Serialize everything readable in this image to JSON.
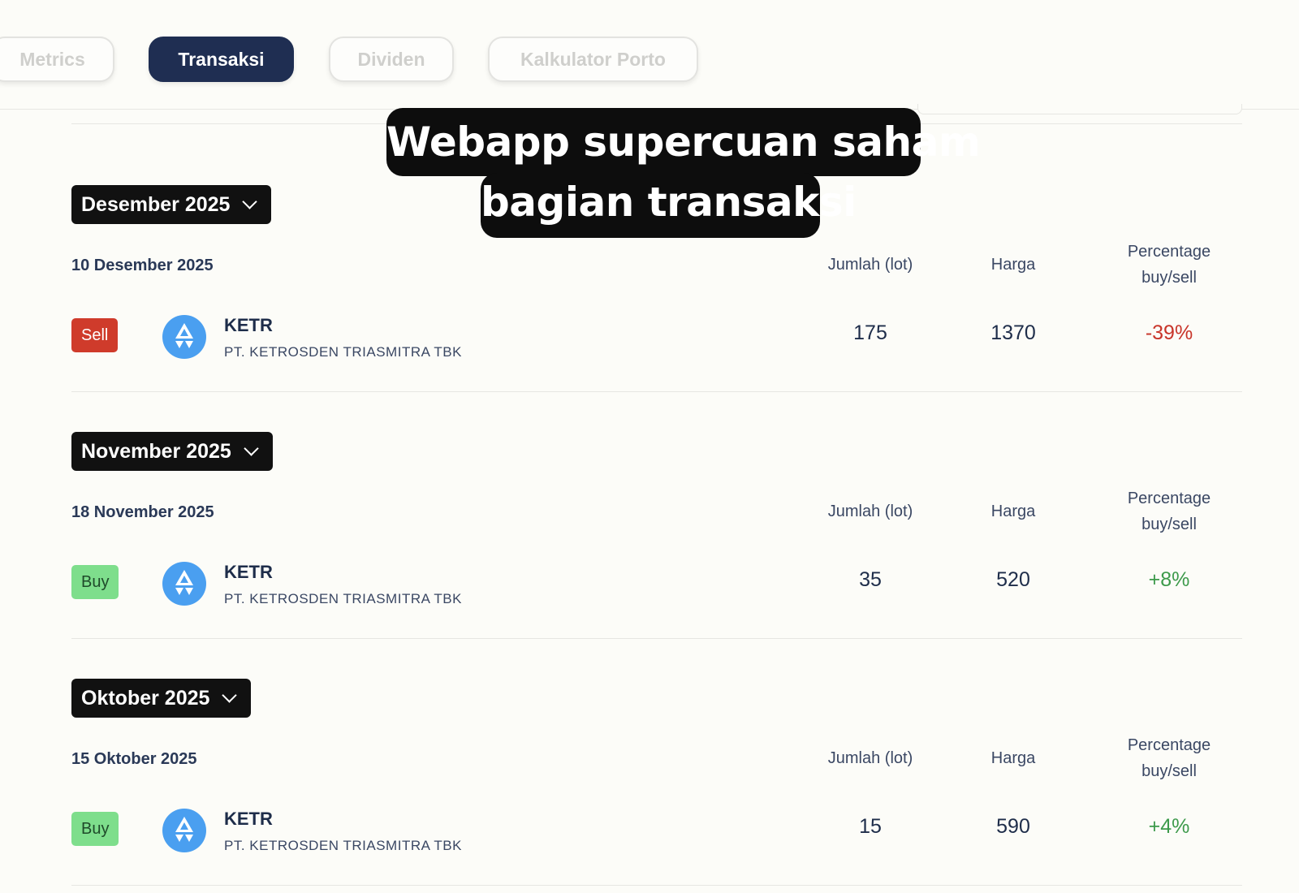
{
  "tabs": [
    {
      "label": "Metrics",
      "active": false
    },
    {
      "label": "Transaksi",
      "active": true
    },
    {
      "label": "Dividen",
      "active": false
    },
    {
      "label": "Kalkulator Porto",
      "active": false
    }
  ],
  "caption": {
    "line1": "Webapp supercuan saham",
    "line2": "bagian transaksi"
  },
  "columns": {
    "jumlah": "Jumlah (lot)",
    "harga": "Harga",
    "percentage_line1": "Percentage",
    "percentage_line2": "buy/sell"
  },
  "colors": {
    "sell": "#cf3b2b",
    "buy": "#7ede8c",
    "negative": "#c8352a",
    "positive": "#3d9a4b",
    "active_tab": "#1f2e52",
    "logo": "#4a9ff0"
  },
  "sections": [
    {
      "month": "Desember 2025",
      "date": "10 Desember 2025",
      "type": "Sell",
      "ticker": "KETR",
      "company": "PT. KETROSDEN TRIASMITRA TBK",
      "jumlah": "175",
      "harga": "1370",
      "percentage": "-39%"
    },
    {
      "month": "November 2025",
      "date": "18 November 2025",
      "type": "Buy",
      "ticker": "KETR",
      "company": "PT. KETROSDEN TRIASMITRA TBK",
      "jumlah": "35",
      "harga": "520",
      "percentage": "+8%"
    },
    {
      "month": "Oktober 2025",
      "date": "15 Oktober 2025",
      "type": "Buy",
      "ticker": "KETR",
      "company": "PT. KETROSDEN TRIASMITRA TBK",
      "jumlah": "15",
      "harga": "590",
      "percentage": "+4%"
    }
  ]
}
